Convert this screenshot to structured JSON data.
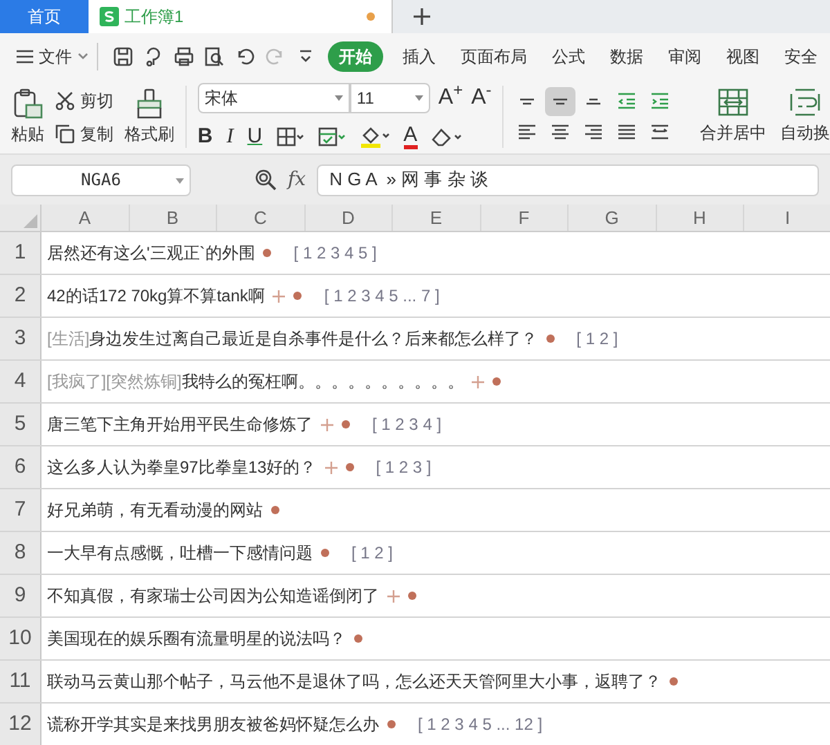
{
  "doc_tabs": [
    {
      "label": "首页",
      "kind": "home",
      "selected": false
    },
    {
      "label": "工作簿1",
      "kind": "sheet",
      "selected": true,
      "unsaved": true
    }
  ],
  "menu": {
    "file": "文件",
    "tabs": [
      {
        "label": "开始",
        "selected": true
      },
      {
        "label": "插入",
        "selected": false
      },
      {
        "label": "页面布局",
        "selected": false
      },
      {
        "label": "公式",
        "selected": false
      },
      {
        "label": "数据",
        "selected": false
      },
      {
        "label": "审阅",
        "selected": false
      },
      {
        "label": "视图",
        "selected": false
      },
      {
        "label": "安全",
        "selected": false
      }
    ]
  },
  "ribbon": {
    "paste": "粘贴",
    "cut": "剪切",
    "copy": "复制",
    "format_painter": "格式刷",
    "font": "宋体",
    "font_size": "11",
    "grow_font": "A$^{+}$",
    "shrink_font": "A$^{-}$",
    "bold": "B",
    "italic": "I",
    "underline": "U",
    "font_color": "A",
    "align_buttons": [
      {
        "kind": "top",
        "selected": false
      },
      {
        "kind": "middle",
        "selected": true
      },
      {
        "kind": "bottom",
        "selected": false
      },
      {
        "kind": "outdent",
        "selected": false
      },
      {
        "kind": "indent",
        "selected": false
      },
      {
        "kind": "left",
        "selected": false
      },
      {
        "kind": "center",
        "selected": false
      },
      {
        "kind": "right",
        "selected": false
      },
      {
        "kind": "justify",
        "selected": false
      },
      {
        "kind": "distribute",
        "selected": false
      }
    ],
    "merge": "合并居中",
    "wrap": "自动换"
  },
  "formula_bar": {
    "name_box": "NGA6",
    "fx": "fx",
    "value": "N G A  » 网 事 杂 谈"
  },
  "columns": [
    "A",
    "B",
    "C",
    "D",
    "E",
    "F",
    "G",
    "H",
    "I"
  ],
  "rows": [
    {
      "number": "1",
      "tags": "",
      "title": "居然还有这么'三观正`的外围",
      "plus": false,
      "pages": "[ 1 2 3 4 5 ]"
    },
    {
      "number": "2",
      "tags": "",
      "title": "42的话172 70kg算不算tank啊",
      "plus": true,
      "pages": "[ 1 2 3 4 5 ... 7 ]"
    },
    {
      "number": "3",
      "tags": "[生活]",
      "title": "身边发生过离自己最近是自杀事件是什么？后来都怎么样了？",
      "plus": false,
      "pages": "[ 1 2 ]"
    },
    {
      "number": "4",
      "tags": "[我疯了][突然炼铜]",
      "title": "我特么的冤枉啊。。。。。。。。。。",
      "plus": true,
      "pages": ""
    },
    {
      "number": "5",
      "tags": "",
      "title": "唐三笔下主角开始用平民生命修炼了",
      "plus": true,
      "pages": "[ 1 2 3 4 ]"
    },
    {
      "number": "6",
      "tags": "",
      "title": "这么多人认为拳皇97比拳皇13好的？",
      "plus": true,
      "pages": "[ 1 2 3 ]"
    },
    {
      "number": "7",
      "tags": "",
      "title": "好兄弟萌，有无看动漫的网站",
      "plus": false,
      "pages": ""
    },
    {
      "number": "8",
      "tags": "",
      "title": "一大早有点感慨，吐槽一下感情问题",
      "plus": false,
      "pages": "[ 1 2 ]"
    },
    {
      "number": "9",
      "tags": "",
      "title": "不知真假，有家瑞士公司因为公知造谣倒闭了",
      "plus": true,
      "pages": ""
    },
    {
      "number": "10",
      "tags": "",
      "title": "美国现在的娱乐圈有流量明星的说法吗？",
      "plus": false,
      "pages": ""
    },
    {
      "number": "11",
      "tags": "",
      "title": "联动马云黄山那个帖子，马云他不是退休了吗，怎么还天天管阿里大小事，返聘了？",
      "plus": false,
      "pages": ""
    },
    {
      "number": "12",
      "tags": "",
      "title": "谎称开学其实是来找男朋友被爸妈怀疑怎么办",
      "plus": false,
      "pages": "[ 1 2 3 4 5 ... 12 ]"
    }
  ]
}
